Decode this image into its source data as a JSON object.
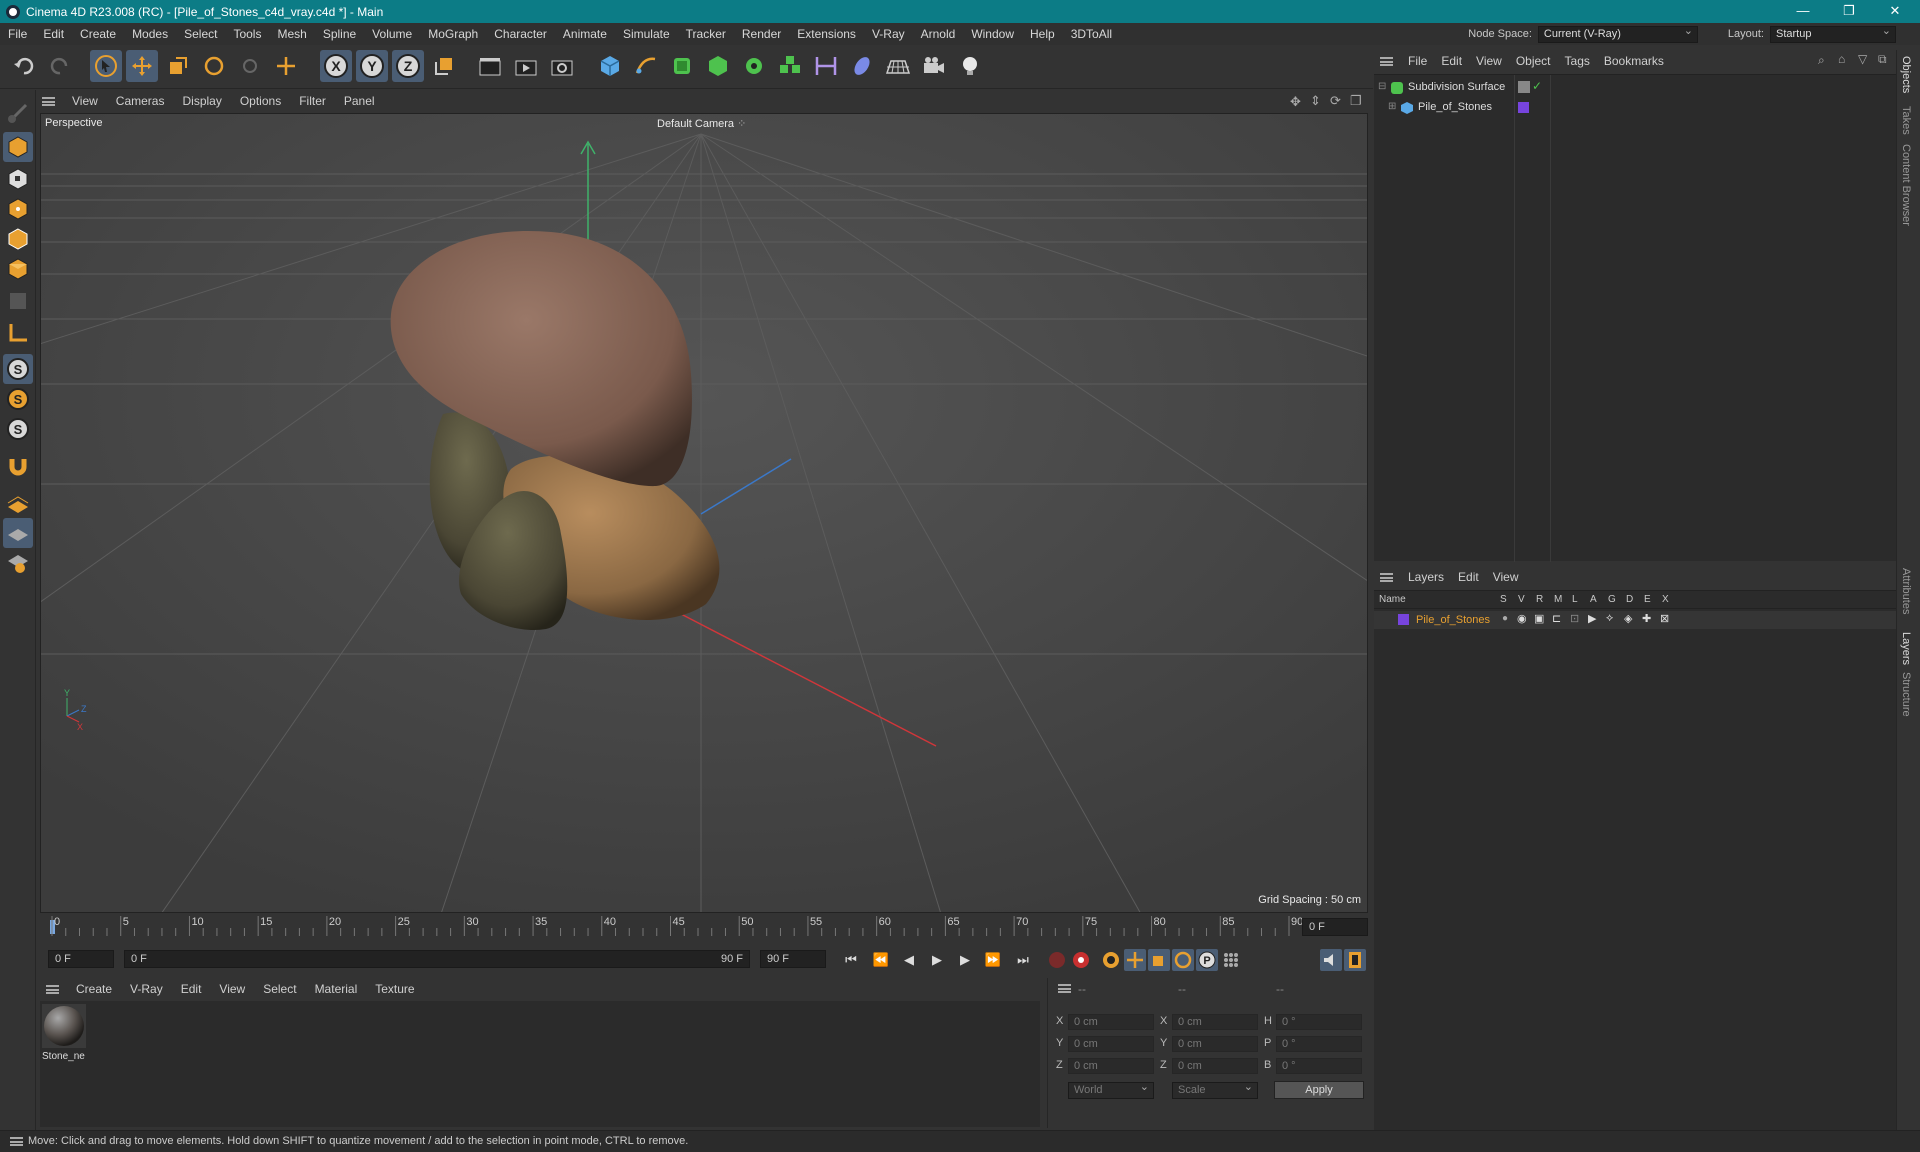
{
  "window": {
    "title": "Cinema 4D R23.008 (RC) - [Pile_of_Stones_c4d_vray.c4d *] - Main",
    "minimize_icon": "minimize-icon",
    "restore_icon": "restore-icon",
    "close_icon": "close-icon"
  },
  "menubar": {
    "items": [
      "File",
      "Edit",
      "Create",
      "Modes",
      "Select",
      "Tools",
      "Mesh",
      "Spline",
      "Volume",
      "MoGraph",
      "Character",
      "Animate",
      "Simulate",
      "Tracker",
      "Render",
      "Extensions",
      "V-Ray",
      "Arnold",
      "Window",
      "Help",
      "3DToAll"
    ],
    "node_space_label": "Node Space:",
    "node_space_value": "Current (V-Ray)",
    "layout_label": "Layout:",
    "layout_value": "Startup"
  },
  "viewport": {
    "menu": [
      "View",
      "Cameras",
      "Display",
      "Options",
      "Filter",
      "Panel"
    ],
    "view_name": "Perspective",
    "camera": "Default Camera",
    "grid_spacing": "Grid Spacing : 50 cm",
    "background": "#4a4a4a"
  },
  "timeline": {
    "ticks": [
      "0",
      "5",
      "10",
      "15",
      "20",
      "25",
      "30",
      "35",
      "40",
      "45",
      "50",
      "55",
      "60",
      "65",
      "70",
      "75",
      "80",
      "85",
      "90"
    ],
    "current_frame": "0 F",
    "start_field": "0 F",
    "range_start": "0 F",
    "range_end": "90 F",
    "end_field": "90 F"
  },
  "material_panel": {
    "menu": [
      "Create",
      "V-Ray",
      "Edit",
      "View",
      "Select",
      "Material",
      "Texture"
    ],
    "materials": [
      {
        "name": "Stone_ne"
      }
    ]
  },
  "coord_panel": {
    "headers": [
      "--",
      "--",
      "--"
    ],
    "rows": [
      {
        "l1": "X",
        "v1": "0 cm",
        "l2": "X",
        "v2": "0 cm",
        "l3": "H",
        "v3": "0 °"
      },
      {
        "l1": "Y",
        "v1": "0 cm",
        "l2": "Y",
        "v2": "0 cm",
        "l3": "P",
        "v3": "0 °"
      },
      {
        "l1": "Z",
        "v1": "0 cm",
        "l2": "Z",
        "v2": "0 cm",
        "l3": "B",
        "v3": "0 °"
      }
    ],
    "space_value": "World",
    "mode_value": "Scale",
    "apply_label": "Apply"
  },
  "objects_panel": {
    "menu": [
      "File",
      "Edit",
      "View",
      "Object",
      "Tags",
      "Bookmarks"
    ],
    "items": [
      {
        "name": "Subdivision Surface",
        "color": "#4ec24e"
      },
      {
        "name": "Pile_of_Stones",
        "color": "#7744dd"
      }
    ]
  },
  "layers_panel": {
    "menu": [
      "Layers",
      "Edit",
      "View"
    ],
    "columns": [
      "Name",
      "S",
      "V",
      "R",
      "M",
      "L",
      "A",
      "G",
      "D",
      "E",
      "X"
    ],
    "layers": [
      {
        "name": "Pile_of_Stones",
        "color": "#7744dd"
      }
    ]
  },
  "side_tabs": [
    "Objects",
    "Takes",
    "Content Browser",
    "Attributes",
    "Layers",
    "Structure"
  ],
  "status": "Move: Click and drag to move elements. Hold down SHIFT to quantize movement / add to the selection in point mode, CTRL to remove."
}
